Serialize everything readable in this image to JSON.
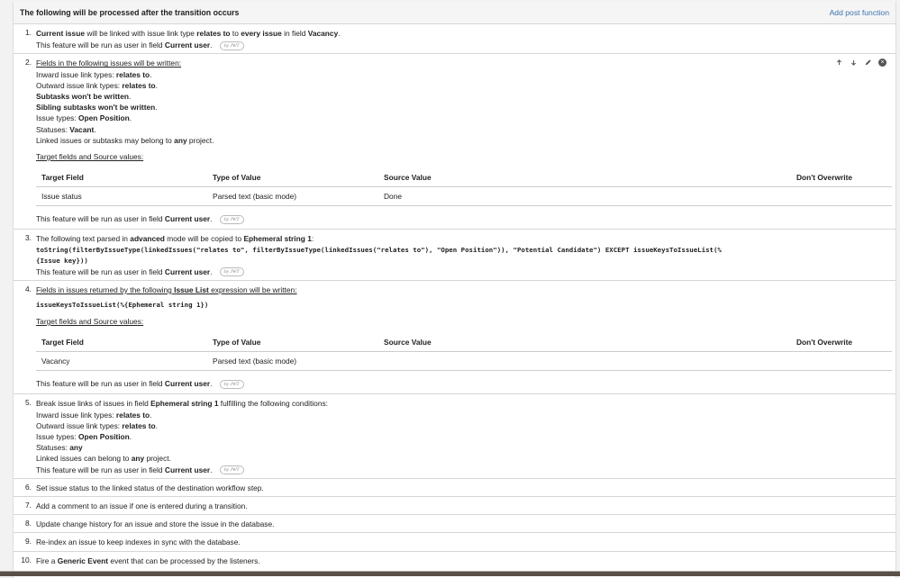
{
  "header": {
    "title": "The following will be processed after the transition occurs",
    "add_link": "Add post function"
  },
  "badge": "by JWT",
  "run_as": {
    "prefix": "This feature will be run as user in field ",
    "field": "Current user",
    "suffix": "."
  },
  "items": [
    {
      "num": "1.",
      "p1": "Current issue",
      "p2": " will be linked with issue link type ",
      "p3": "relates to",
      "p4": " to ",
      "p5": "every issue",
      "p6": " in field ",
      "p7": "Vacancy",
      "p8": "."
    },
    {
      "num": "2.",
      "heading": "Fields in the following issues will be written:",
      "inward_label": "Inward issue link types: ",
      "inward_value": "relates to",
      "outward_label": "Outward issue link types: ",
      "outward_value": "relates to",
      "subtasks": "Subtasks won't be written",
      "siblings": "Sibling subtasks won't be written",
      "types_label": "Issue types: ",
      "types_value": "Open Position",
      "statuses_label": "Statuses: ",
      "statuses_value": "Vacant",
      "linked_pre": "Linked issues or subtasks may belong to ",
      "linked_bold": "any",
      "linked_post": " project.",
      "target_heading": "Target fields and Source values:",
      "columns": [
        "Target Field",
        "Type of Value",
        "Source Value",
        "Don't Overwrite"
      ],
      "rows": [
        [
          "Issue status",
          "Parsed text (basic mode)",
          "Done",
          ""
        ]
      ]
    },
    {
      "num": "3.",
      "p1": "The following text parsed in ",
      "p2": "advanced",
      "p3": " mode will be copied to ",
      "p4": "Ephemeral string 1",
      "p5": ":",
      "code1": "toString(filterByIssueType(linkedIssues(\"relates to\", filterByIssueType(linkedIssues(\"relates to\"), \"Open Position\")), \"Potential Candidate\") EXCEPT issueKeysToIssueList(%",
      "code2": "{Issue key}))"
    },
    {
      "num": "4.",
      "h1": "Fields in issues returned by the following ",
      "h2": "Issue List",
      "h3": " expression will be written:",
      "code": "issueKeysToIssueList(%{Ephemeral string 1})",
      "target_heading": "Target fields and Source values:",
      "columns": [
        "Target Field",
        "Type of Value",
        "Source Value",
        "Don't Overwrite"
      ],
      "rows": [
        [
          "Vacancy",
          "Parsed text (basic mode)",
          "",
          ""
        ]
      ]
    },
    {
      "num": "5.",
      "p1": "Break issue links of issues in field ",
      "p2": "Ephemeral string 1",
      "p3": " fulfilling the following conditions:",
      "inward_label": "Inward issue link types: ",
      "inward_value": "relates to",
      "outward_label": "Outward issue link types: ",
      "outward_value": "relates to",
      "types_label": "Issue types: ",
      "types_value": "Open Position",
      "statuses_label": "Statuses: ",
      "statuses_value": "any",
      "linked_pre": "Linked issues can belong to ",
      "linked_bold": "any",
      "linked_post": " project."
    },
    {
      "num": "6.",
      "text": "Set issue status to the linked status of the destination workflow step."
    },
    {
      "num": "7.",
      "text": "Add a comment to an issue if one is entered during a transition."
    },
    {
      "num": "8.",
      "text": "Update change history for an issue and store the issue in the database."
    },
    {
      "num": "9.",
      "text": "Re-index an issue to keep indexes in sync with the database."
    },
    {
      "num": "10.",
      "p1": "Fire a ",
      "p2": "Generic Event",
      "p3": " event that can be processed by the listeners."
    }
  ]
}
